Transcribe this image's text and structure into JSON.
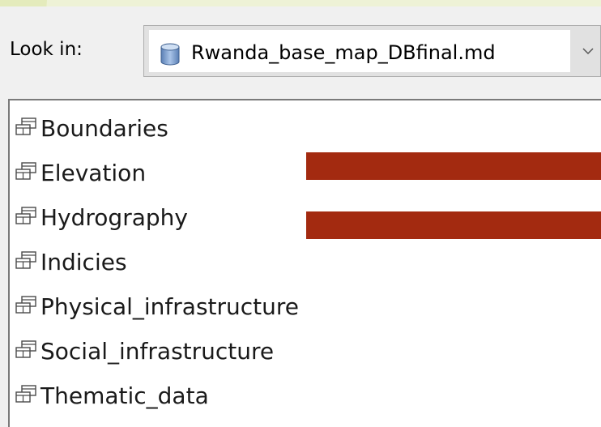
{
  "look_in": {
    "label": "Look in:",
    "selected": "Rwanda_base_map_DBfinal.md",
    "icon": "database-icon"
  },
  "items": [
    {
      "label": "Boundaries",
      "icon": "feature-dataset-icon"
    },
    {
      "label": "Elevation",
      "icon": "feature-dataset-icon"
    },
    {
      "label": "Hydrography",
      "icon": "feature-dataset-icon"
    },
    {
      "label": "Indicies",
      "icon": "feature-dataset-icon"
    },
    {
      "label": "Physical_infrastructure",
      "icon": "feature-dataset-icon"
    },
    {
      "label": "Social_infrastructure",
      "icon": "feature-dataset-icon"
    },
    {
      "label": "Thematic_data",
      "icon": "feature-dataset-icon"
    }
  ],
  "colors": {
    "redaction": "#a32a10",
    "background": "#eef2d6"
  }
}
